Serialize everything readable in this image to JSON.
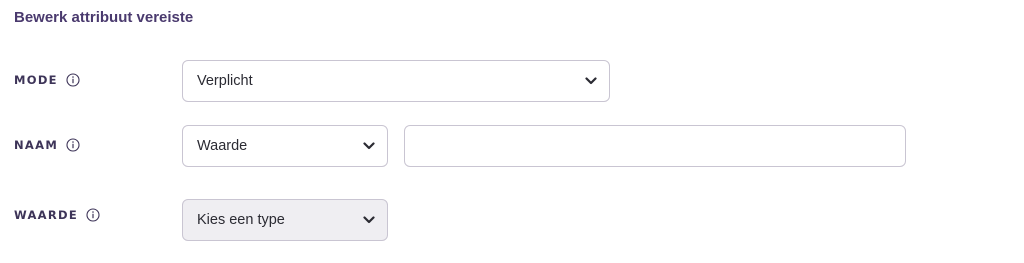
{
  "title": "Bewerk attribuut vereiste",
  "rows": {
    "mode": {
      "label": "MODE",
      "info_icon": "info-circle-icon",
      "select_value": "Verplicht"
    },
    "naam": {
      "label": "NAAM",
      "info_icon": "info-circle-icon",
      "select_value": "Waarde",
      "text_value": ""
    },
    "waarde": {
      "label": "WAARDE",
      "info_icon": "info-circle-icon",
      "select_value": "Kies een type"
    }
  },
  "colors": {
    "title": "#4a3a6e",
    "label": "#3d3458",
    "border": "#c9c5d2",
    "disabled_bg": "#efeef2"
  }
}
